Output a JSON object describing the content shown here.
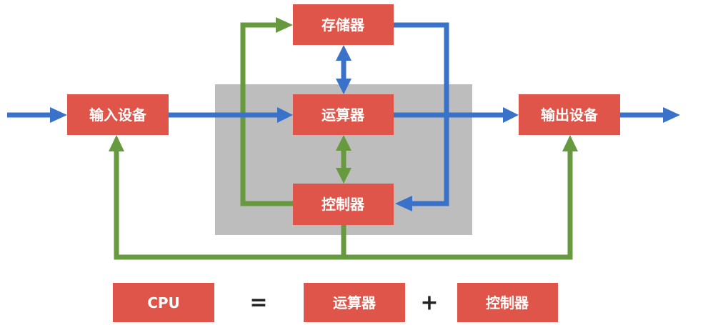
{
  "diagram": {
    "nodes": {
      "memory": "存储器",
      "alu": "运算器",
      "controller": "控制器",
      "input": "输入设备",
      "output": "输出设备"
    },
    "equation": {
      "lhs": "CPU",
      "equals": "=",
      "term1": "运算器",
      "plus": "+",
      "term2": "控制器"
    },
    "colors": {
      "box": "#E0554A",
      "data_flow": "#3A72C9",
      "control_flow": "#67993F",
      "cpu_region": "#BDBDBD"
    }
  }
}
